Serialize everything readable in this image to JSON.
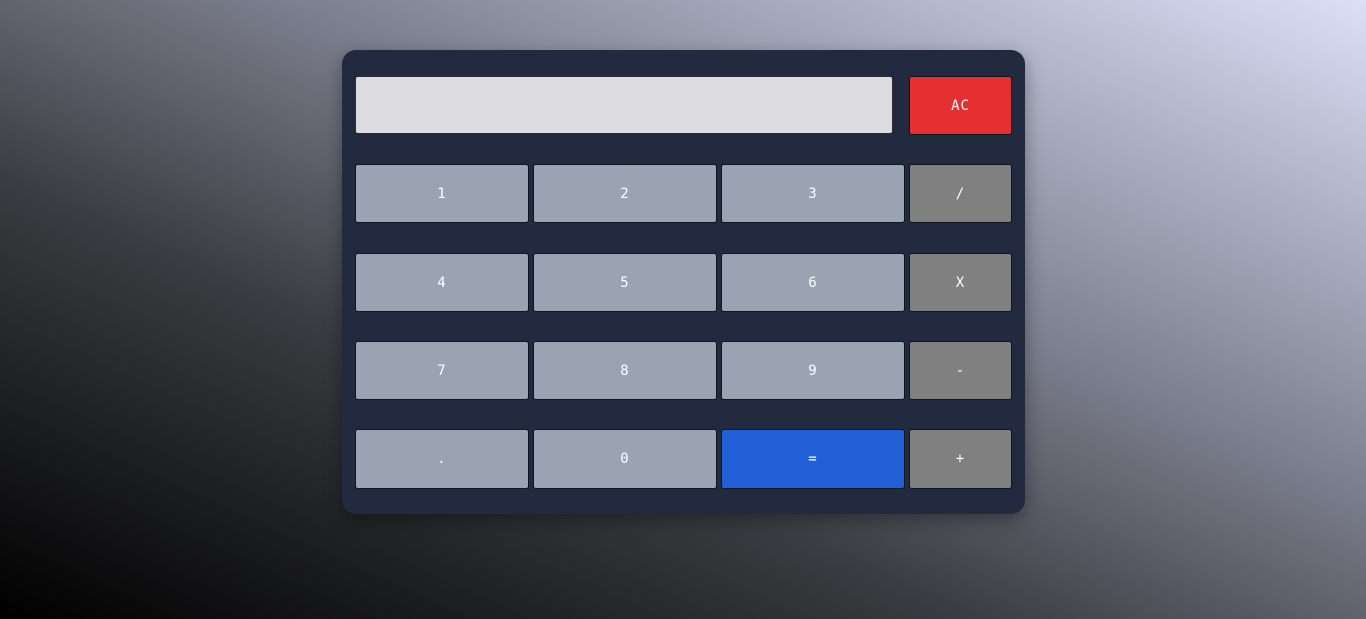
{
  "display": {
    "value": "",
    "placeholder": ""
  },
  "keys": {
    "clear": "AC",
    "one": "1",
    "two": "2",
    "three": "3",
    "divide": "/",
    "four": "4",
    "five": "5",
    "six": "6",
    "multiply": "X",
    "seven": "7",
    "eight": "8",
    "nine": "9",
    "subtract": "-",
    "decimal": ".",
    "zero": "0",
    "equals": "=",
    "add": "+"
  },
  "colors": {
    "panel": "#212a3e",
    "number_key": "#9aa3b1",
    "operator_key": "#808080",
    "clear_key": "#e62f30",
    "equals_key": "#215fd6",
    "display_bg": "#dcdce1"
  }
}
